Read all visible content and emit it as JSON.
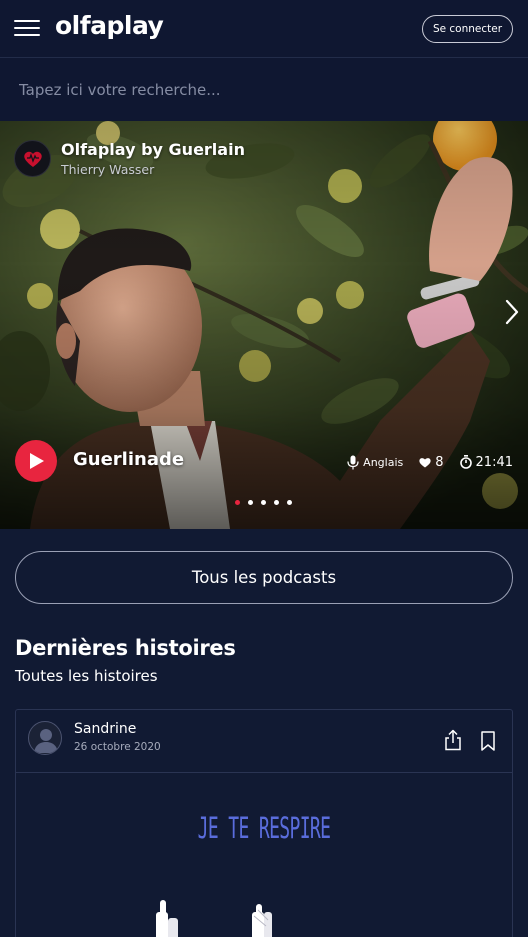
{
  "header": {
    "logo": "olfaplay",
    "login_label": "Se connecter"
  },
  "search": {
    "placeholder": "Tapez ici votre recherche..."
  },
  "hero": {
    "channel_title": "Olfaplay by Guerlain",
    "channel_subtitle": "Thierry Wasser",
    "episode_title": "Guerlinade",
    "language": "Anglais",
    "likes": "8",
    "duration": "21:41",
    "slide_count": 5,
    "active_slide": 1,
    "colors": {
      "play": "#e8253f",
      "active_dot": "#e8253f"
    }
  },
  "all_podcasts_label": "Tous les podcasts",
  "section": {
    "title": "Dernières histoires",
    "link": "Toutes les histoires"
  },
  "story": {
    "author": "Sandrine",
    "date": "26 octobre 2020",
    "title": "JE TE RESPIRE",
    "title_color": "#5a6ddc"
  },
  "icons": {
    "menu": "hamburger-icon",
    "play": "play-icon",
    "mic": "microphone-icon",
    "likes": "heart-icon",
    "duration": "stopwatch-icon",
    "next": "chevron-right-icon",
    "share": "share-icon",
    "bookmark": "bookmark-icon"
  },
  "colors": {
    "background": "#111a33",
    "header": "#0f1731",
    "border": "#2a3453"
  }
}
